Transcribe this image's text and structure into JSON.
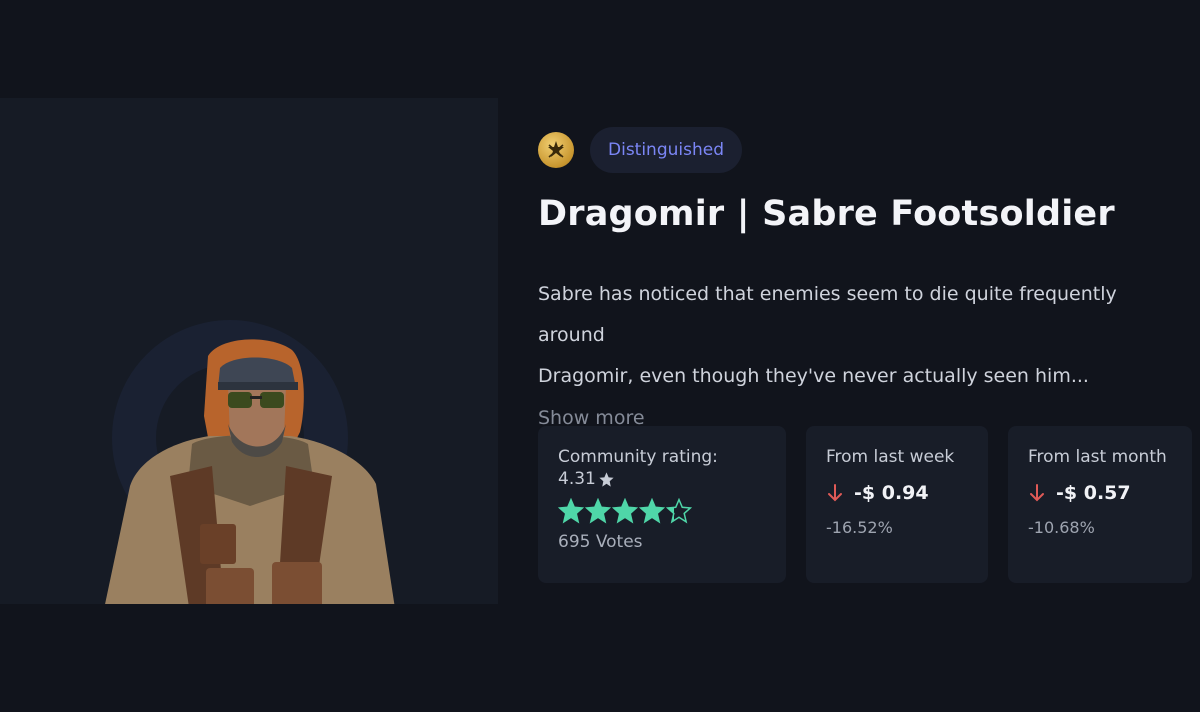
{
  "item": {
    "rarity": "Distinguished",
    "name": "Dragomir | Sabre Footsoldier",
    "description_line1": "Sabre has noticed that enemies seem to die quite frequently around",
    "description_line2": "Dragomir, even though they've never actually seen him...",
    "show_more_label": "Show more",
    "rarity_icon": "rank-badge-icon"
  },
  "stats": {
    "rating": {
      "label": "Community rating:",
      "value": "4.31",
      "stars_filled": 4.31,
      "votes": "695 Votes"
    },
    "week": {
      "label": "From last week",
      "value": "-$ 0.94",
      "percent": "-16.52%"
    },
    "month": {
      "label": "From last month",
      "value": "-$ 0.57",
      "percent": "-10.68%"
    }
  },
  "colors": {
    "accent": "#7b86f5",
    "star": "#4fd6a8",
    "down": "#e05a57",
    "background": "#11141c"
  }
}
